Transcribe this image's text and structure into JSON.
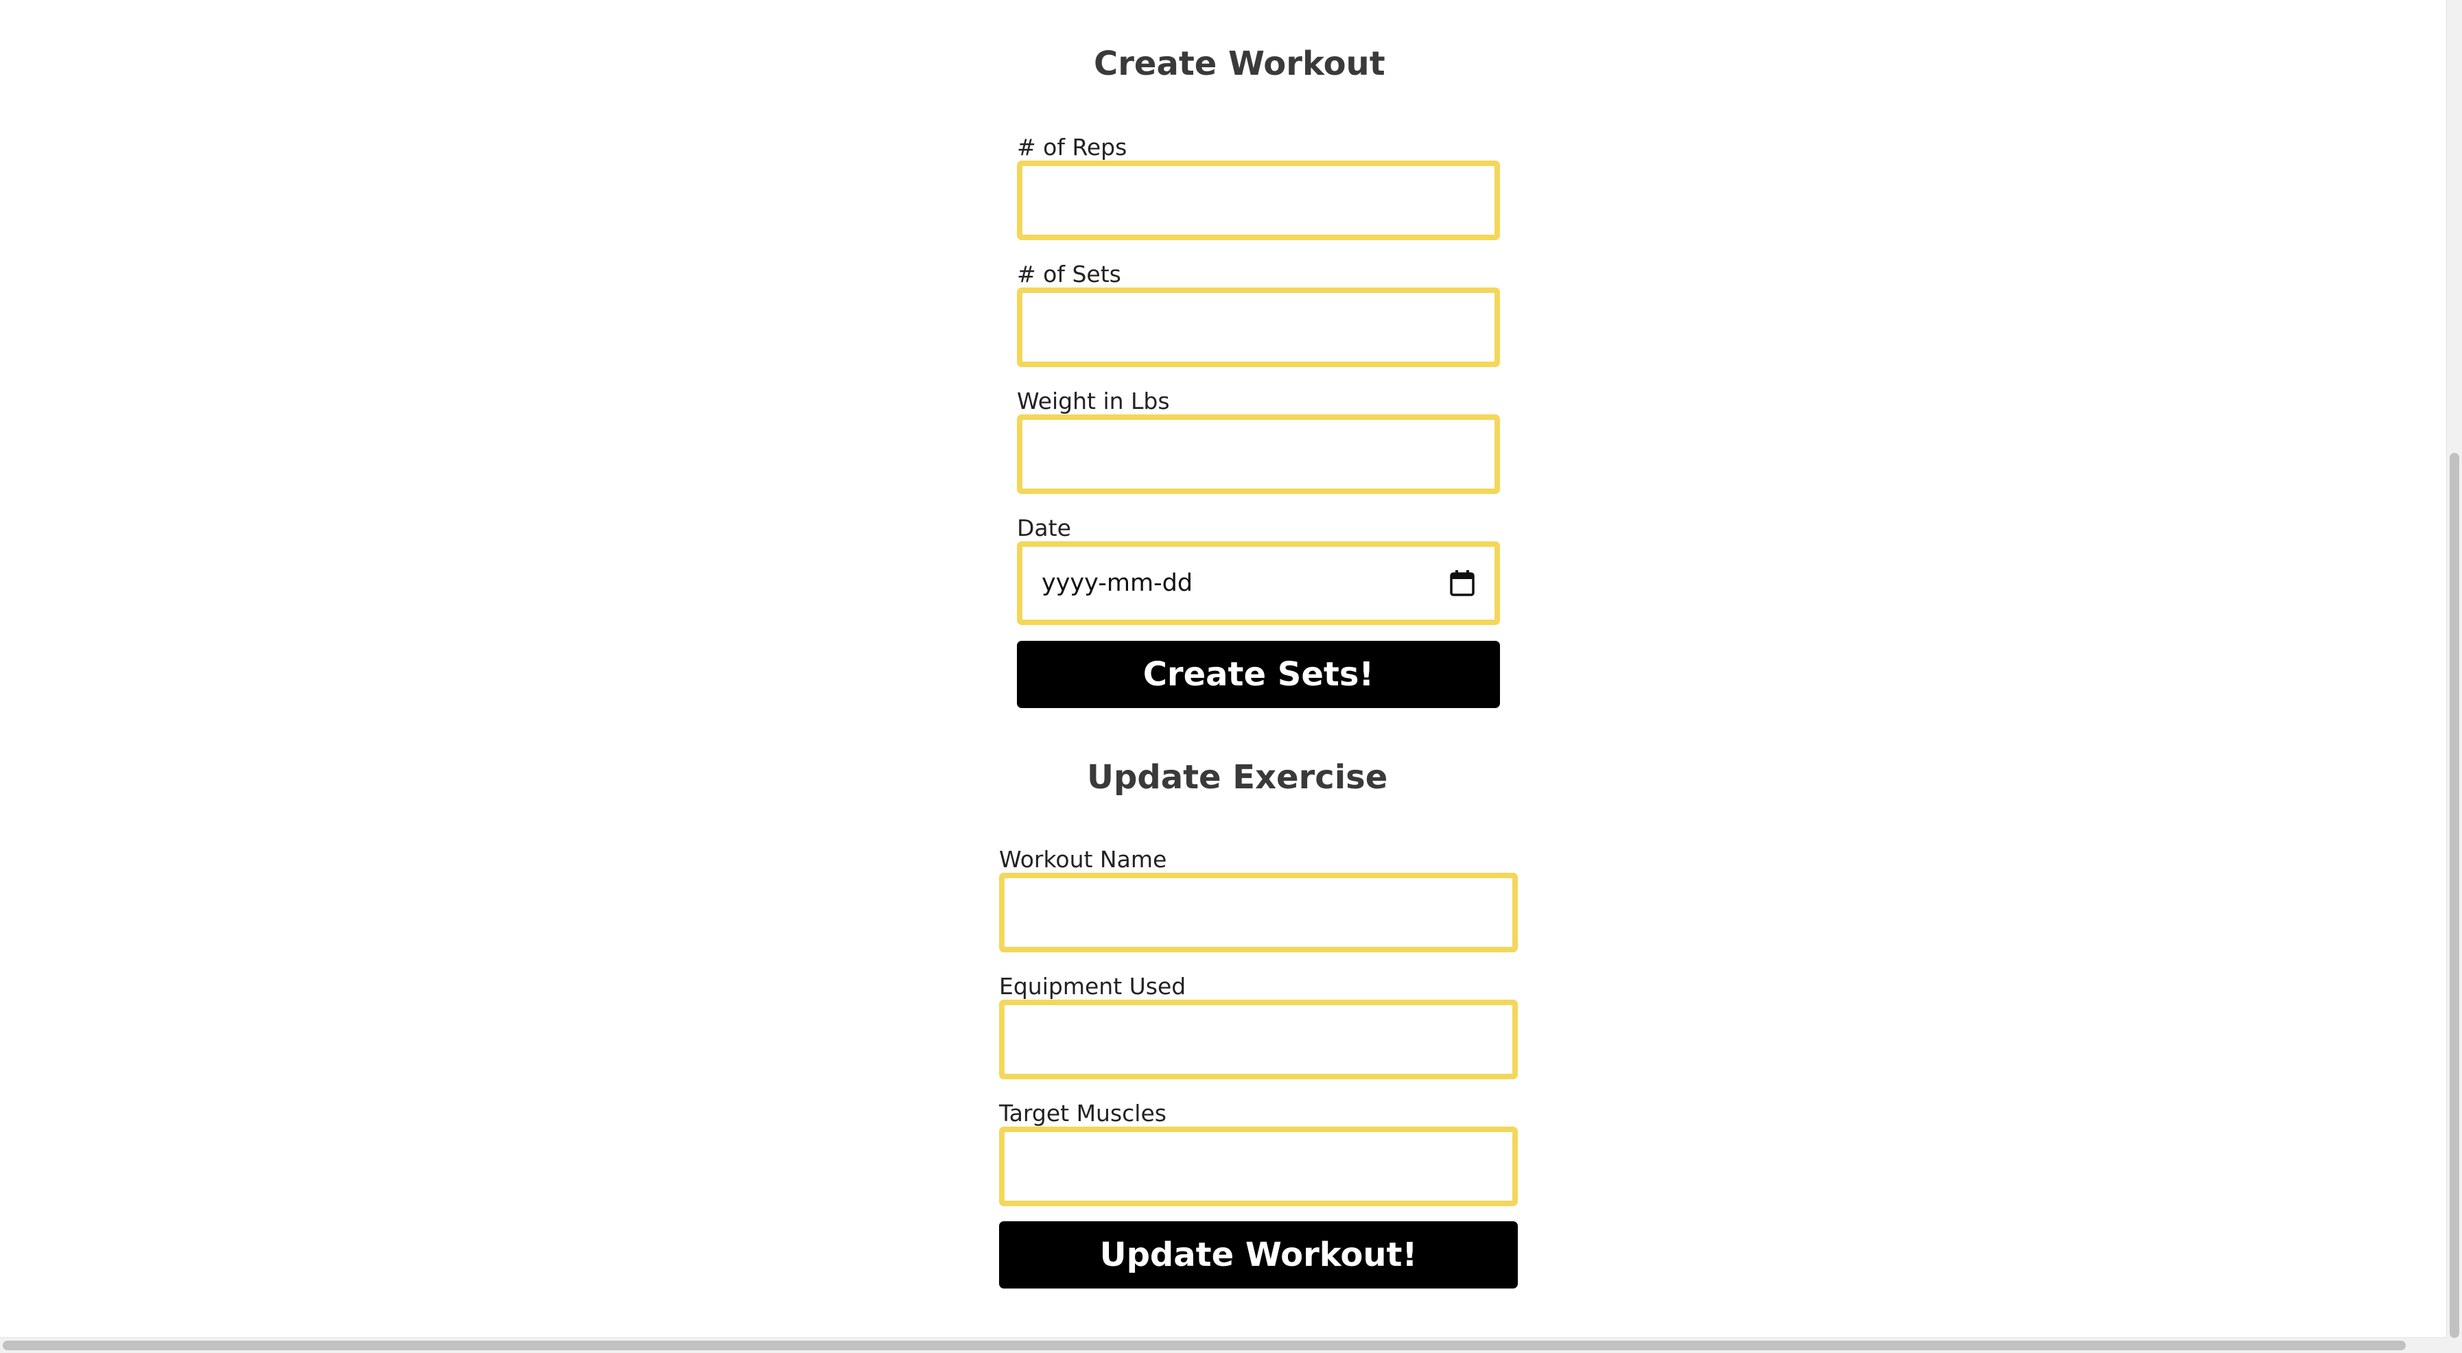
{
  "create_workout": {
    "title": "Create Workout",
    "reps_label": "# of Reps",
    "reps_value": "",
    "sets_label": "# of Sets",
    "sets_value": "",
    "weight_label": "Weight in Lbs",
    "weight_value": "",
    "date_label": "Date",
    "date_placeholder": "yyyy-mm-dd",
    "submit_label": "Create Sets!"
  },
  "update_exercise": {
    "title": "Update Exercise",
    "name_label": "Workout Name",
    "name_value": "",
    "equipment_label": "Equipment Used",
    "equipment_value": "",
    "muscles_label": "Target Muscles",
    "muscles_value": "",
    "submit_label": "Update Workout!"
  },
  "icons": {
    "date_picker": "calendar-icon"
  },
  "colors": {
    "input_border": "#f4d75a",
    "button_bg": "#000000",
    "button_text": "#ffffff",
    "heading": "#3a3a3a"
  }
}
